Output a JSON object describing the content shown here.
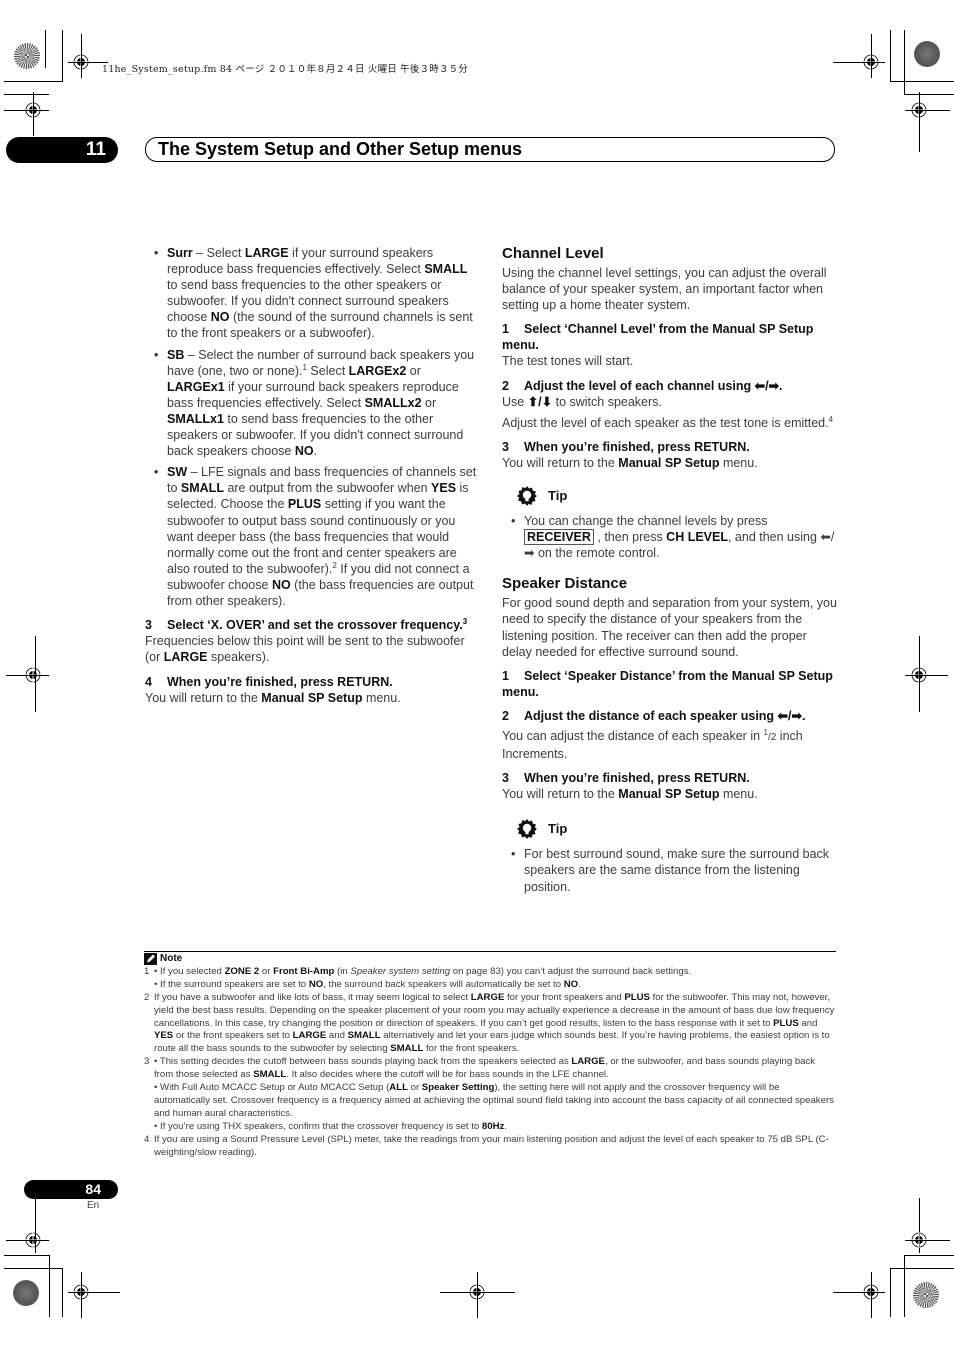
{
  "header": {
    "file_meta": "11he_System_setup.fm  84 ページ  ２０１０年８月２４日  火曜日  午後３時３５分",
    "chapter_number": "11",
    "chapter_title": "The System Setup and Other Setup menus"
  },
  "left_column": {
    "bullets": [
      {
        "term": "Surr",
        "parts": [
          " – Select ",
          "LARGE",
          " if your surround speakers reproduce bass frequencies effectively. Select ",
          "SMALL",
          " to send bass frequencies to the other speakers or subwoofer. If you didn't connect surround speakers choose ",
          "NO",
          " (the sound of the surround channels is sent to the front speakers or a subwoofer)."
        ]
      },
      {
        "term": "SB",
        "parts": [
          " – Select the number of surround back speakers you have (one, two or none).",
          "1",
          " Select ",
          "LARGEx2",
          " or ",
          "LARGEx1",
          " if your surround back speakers reproduce bass frequencies effectively. Select ",
          "SMALLx2",
          " or ",
          "SMALLx1",
          " to send bass frequencies to the other speakers or subwoofer. If you didn't connect surround back speakers choose ",
          "NO",
          "."
        ]
      },
      {
        "term": "SW",
        "parts": [
          " – LFE signals and bass frequencies of channels set to ",
          "SMALL",
          " are output from the subwoofer when ",
          "YES",
          " is selected. Choose the ",
          "PLUS",
          " setting if you want the subwoofer to output bass sound continuously or you want deeper bass (the bass frequencies that would normally come out the front and center speakers are also routed to the subwoofer).",
          "2",
          " If you did not connect a subwoofer choose ",
          "NO",
          " (the bass frequencies are output from other speakers)."
        ]
      }
    ],
    "step3": {
      "num": "3",
      "title": "Select ‘X. OVER’ and set the crossover frequency.",
      "sup": "3",
      "body_pre": "Frequencies below this point will be sent to the subwoofer (or ",
      "body_bold": "LARGE",
      "body_post": " speakers)."
    },
    "step4": {
      "num": "4",
      "title": "When you’re finished, press RETURN.",
      "body_pre": "You will return to the ",
      "body_bold": "Manual SP Setup",
      "body_post": " menu."
    }
  },
  "channel_level": {
    "heading": "Channel Level",
    "intro": "Using the channel level settings, you can adjust the overall balance of your speaker system, an important factor when setting up a home theater system.",
    "step1": {
      "num": "1",
      "title": "Select ‘Channel Level’ from the Manual SP Setup menu.",
      "body": "The test tones will start."
    },
    "step2": {
      "num": "2",
      "title": "Adjust the level of each channel using ⬅/➡.",
      "body1_pre": "Use ",
      "body1_arrows": "⬆/⬇",
      "body1_post": " to switch speakers.",
      "body2": "Adjust the level of each speaker as the test tone is emitted.",
      "body2_sup": "4"
    },
    "step3": {
      "num": "3",
      "title": "When you’re finished, press RETURN.",
      "body_pre": "You will return to the ",
      "body_bold": "Manual SP Setup",
      "body_post": " menu."
    },
    "tip": {
      "label": "Tip",
      "pre": "You can change the channel levels by press ",
      "key": "RECEIVER",
      "mid": " , then press ",
      "bold": "CH LEVEL",
      "post": ", and then using ⬅/ ➡ on the remote control."
    }
  },
  "speaker_distance": {
    "heading": "Speaker Distance",
    "intro": "For good sound depth and separation from your system, you need to specify the distance of your speakers from the listening position. The receiver can then add the proper delay needed for effective surround sound.",
    "step1": {
      "num": "1",
      "title": "Select ‘Speaker Distance’ from the Manual SP Setup menu."
    },
    "step2": {
      "num": "2",
      "title": "Adjust the distance of each speaker using ⬅/➡.",
      "body_pre": "You can adjust the distance of each speaker in ",
      "frac_num": "1",
      "frac_den": "/2",
      "body_post": " inch Increments."
    },
    "step3": {
      "num": "3",
      "title": "When you’re finished, press RETURN.",
      "body_pre": "You will return to the ",
      "body_bold": "Manual SP Setup",
      "body_post": " menu."
    },
    "tip": {
      "label": "Tip",
      "text": "For best surround sound, make sure the surround back speakers are the same distance from the listening position."
    }
  },
  "notes": {
    "label": "Note",
    "items": [
      {
        "num": "1",
        "lines": [
          [
            "• If you selected ",
            "ZONE 2",
            " or ",
            "Front Bi-Amp",
            " (in ",
            "Speaker system setting",
            " on page 83) you can’t adjust the surround back settings."
          ],
          [
            "• If the surround speakers are set to ",
            "NO",
            ", the surround back speakers will automatically be set to ",
            "NO",
            "."
          ]
        ]
      },
      {
        "num": "2",
        "lines": [
          [
            "If you have a subwoofer and like lots of bass, it may seem logical to select ",
            "LARGE",
            " for your front speakers and ",
            "PLUS",
            " for the subwoofer. This may not, however, yield the best bass results. Depending on the speaker placement of your room you may actually experience a decrease in the amount of bass due low frequency cancellations. In this case, try changing the position or direction of speakers. If you can’t get good results, listen to the bass response with it set to ",
            "PLUS",
            " and ",
            "YES",
            " or the front speakers set to ",
            "LARGE",
            " and ",
            "SMALL",
            " alternatively and let your ears judge which sounds best. If you’re having problems, the easiest option is to route all the bass sounds to the subwoofer by selecting ",
            "SMALL",
            " for the front speakers."
          ]
        ]
      },
      {
        "num": "3",
        "lines": [
          [
            "• This setting decides the cutoff between bass sounds playing back from the speakers selected as ",
            "LARGE",
            ", or the subwoofer, and bass sounds playing back from those selected as ",
            "SMALL",
            ". It also decides where the cutoff will be for bass sounds in the LFE channel."
          ],
          [
            "• With Full Auto MCACC Setup or Auto MCACC Setup (",
            "ALL",
            " or ",
            "Speaker Setting",
            "), the setting here will not apply and the crossover frequency will be automatically set. Crossover frequency is a frequency aimed at achieving the optimal sound field taking into account the bass capacity of all connected speakers and human aural characteristics."
          ],
          [
            "• If you’re using THX speakers, confirm that the crossover frequency is set to ",
            "80Hz",
            "."
          ]
        ]
      },
      {
        "num": "4",
        "lines": [
          [
            "If you are using a Sound Pressure Level (SPL) meter, take the readings from your main listening position and adjust the level of each speaker to 75 dB SPL (C-weighting/slow reading)."
          ]
        ]
      }
    ]
  },
  "footer": {
    "page_number": "84",
    "language": "En"
  }
}
